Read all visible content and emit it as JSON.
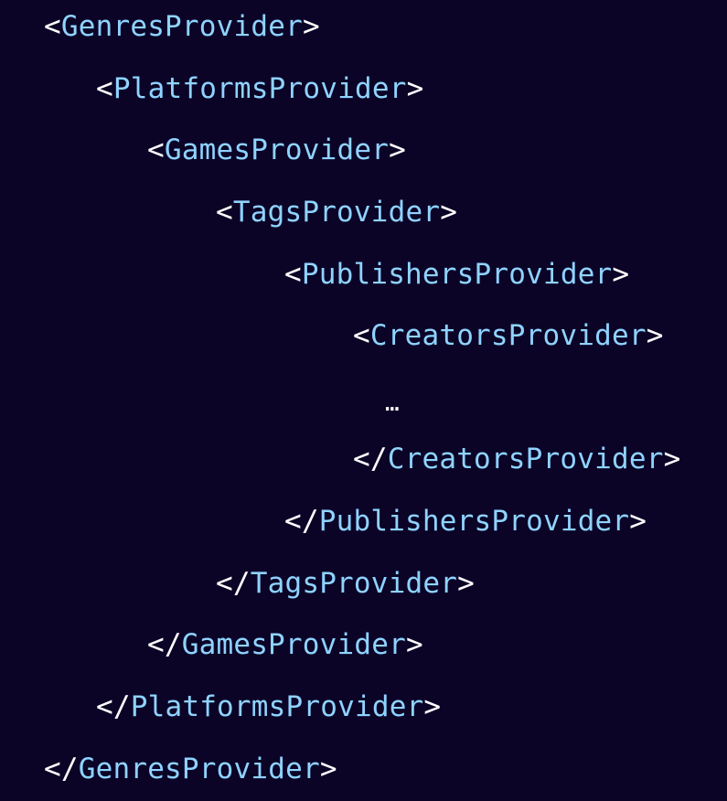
{
  "colors": {
    "background": "#0b0427",
    "tag_name": "#8fd3ff",
    "punctuation": "#ffffff"
  },
  "code": {
    "open_bracket": "<",
    "close_bracket": ">",
    "closing_open_bracket": "</",
    "ellipsis": "…",
    "tags": {
      "genres": "GenresProvider",
      "platforms": "PlatformsProvider",
      "games": "GamesProvider",
      "tags": "TagsProvider",
      "publishers": "PublishersProvider",
      "creators": "CreatorsProvider"
    }
  }
}
